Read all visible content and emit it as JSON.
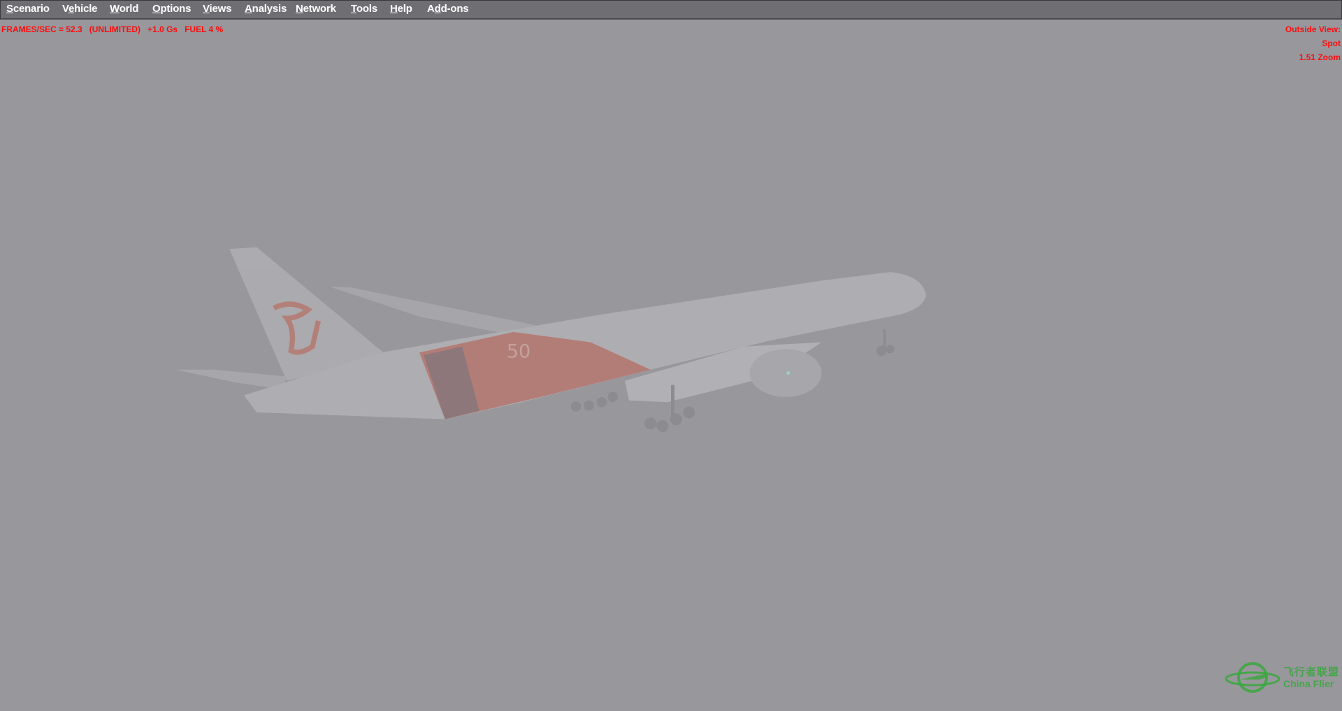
{
  "menu": {
    "items": [
      {
        "pre": "",
        "accel": "S",
        "post": "cenario"
      },
      {
        "pre": "V",
        "accel": "e",
        "post": "hicle"
      },
      {
        "pre": "",
        "accel": "W",
        "post": "orld"
      },
      {
        "pre": "",
        "accel": "O",
        "post": "ptions"
      },
      {
        "pre": "",
        "accel": "V",
        "post": "iews"
      },
      {
        "pre": "",
        "accel": "A",
        "post": "nalysis"
      },
      {
        "pre": "",
        "accel": "N",
        "post": "etwork"
      },
      {
        "pre": "",
        "accel": "T",
        "post": "ools"
      },
      {
        "pre": "",
        "accel": "H",
        "post": "elp"
      },
      {
        "pre": "A",
        "accel": "d",
        "post": "d-ons"
      }
    ]
  },
  "hud": {
    "frames": "FRAMES/SEC = 52.3",
    "limit": "(UNLIMITED)",
    "gforce": "+1.0 Gs",
    "fuel": "FUEL 4 %",
    "view_label": "Outside View:",
    "view_mode": "Spot",
    "zoom": "1.51 Zoom"
  },
  "watermark": {
    "cn": "飞行者联盟",
    "en": "China Flier"
  },
  "colors": {
    "hud_text": "#ff0d0d",
    "sky": "#98979c",
    "logo": "#3aa73f",
    "livery_red": "#b87268"
  }
}
